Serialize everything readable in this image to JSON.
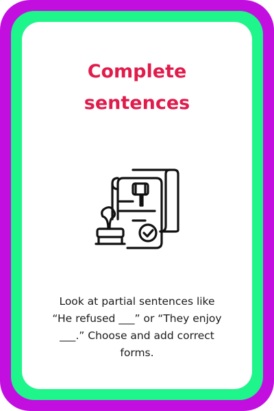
{
  "card": {
    "colors": {
      "outer_border": "#c20fe0",
      "inner_border": "#1ef58a",
      "background": "#ffffff",
      "title": "#e01c4c",
      "text": "#1a1a1a"
    },
    "title_lines": [
      "Complete",
      "sentences"
    ],
    "icon": "legal-document-with-gavel-and-stamp-icon",
    "description_lines": [
      "Look at partial sentences like",
      "“He refused ___” or “They enjoy",
      "___.” Choose and add correct",
      "forms."
    ]
  }
}
